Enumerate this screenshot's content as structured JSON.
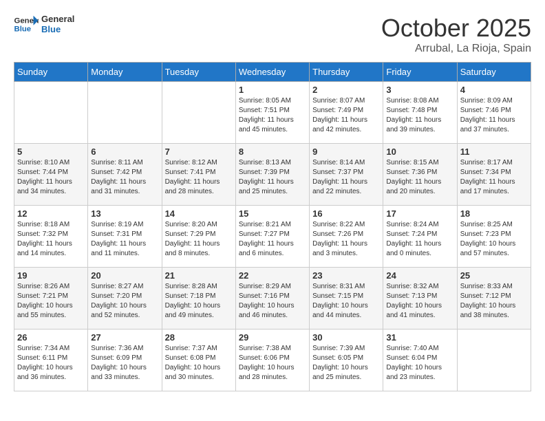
{
  "logo": {
    "line1": "General",
    "line2": "Blue"
  },
  "title": "October 2025",
  "subtitle": "Arrubal, La Rioja, Spain",
  "weekdays": [
    "Sunday",
    "Monday",
    "Tuesday",
    "Wednesday",
    "Thursday",
    "Friday",
    "Saturday"
  ],
  "weeks": [
    [
      {
        "day": "",
        "info": ""
      },
      {
        "day": "",
        "info": ""
      },
      {
        "day": "",
        "info": ""
      },
      {
        "day": "1",
        "info": "Sunrise: 8:05 AM\nSunset: 7:51 PM\nDaylight: 11 hours and 45 minutes."
      },
      {
        "day": "2",
        "info": "Sunrise: 8:07 AM\nSunset: 7:49 PM\nDaylight: 11 hours and 42 minutes."
      },
      {
        "day": "3",
        "info": "Sunrise: 8:08 AM\nSunset: 7:48 PM\nDaylight: 11 hours and 39 minutes."
      },
      {
        "day": "4",
        "info": "Sunrise: 8:09 AM\nSunset: 7:46 PM\nDaylight: 11 hours and 37 minutes."
      }
    ],
    [
      {
        "day": "5",
        "info": "Sunrise: 8:10 AM\nSunset: 7:44 PM\nDaylight: 11 hours and 34 minutes."
      },
      {
        "day": "6",
        "info": "Sunrise: 8:11 AM\nSunset: 7:42 PM\nDaylight: 11 hours and 31 minutes."
      },
      {
        "day": "7",
        "info": "Sunrise: 8:12 AM\nSunset: 7:41 PM\nDaylight: 11 hours and 28 minutes."
      },
      {
        "day": "8",
        "info": "Sunrise: 8:13 AM\nSunset: 7:39 PM\nDaylight: 11 hours and 25 minutes."
      },
      {
        "day": "9",
        "info": "Sunrise: 8:14 AM\nSunset: 7:37 PM\nDaylight: 11 hours and 22 minutes."
      },
      {
        "day": "10",
        "info": "Sunrise: 8:15 AM\nSunset: 7:36 PM\nDaylight: 11 hours and 20 minutes."
      },
      {
        "day": "11",
        "info": "Sunrise: 8:17 AM\nSunset: 7:34 PM\nDaylight: 11 hours and 17 minutes."
      }
    ],
    [
      {
        "day": "12",
        "info": "Sunrise: 8:18 AM\nSunset: 7:32 PM\nDaylight: 11 hours and 14 minutes."
      },
      {
        "day": "13",
        "info": "Sunrise: 8:19 AM\nSunset: 7:31 PM\nDaylight: 11 hours and 11 minutes."
      },
      {
        "day": "14",
        "info": "Sunrise: 8:20 AM\nSunset: 7:29 PM\nDaylight: 11 hours and 8 minutes."
      },
      {
        "day": "15",
        "info": "Sunrise: 8:21 AM\nSunset: 7:27 PM\nDaylight: 11 hours and 6 minutes."
      },
      {
        "day": "16",
        "info": "Sunrise: 8:22 AM\nSunset: 7:26 PM\nDaylight: 11 hours and 3 minutes."
      },
      {
        "day": "17",
        "info": "Sunrise: 8:24 AM\nSunset: 7:24 PM\nDaylight: 11 hours and 0 minutes."
      },
      {
        "day": "18",
        "info": "Sunrise: 8:25 AM\nSunset: 7:23 PM\nDaylight: 10 hours and 57 minutes."
      }
    ],
    [
      {
        "day": "19",
        "info": "Sunrise: 8:26 AM\nSunset: 7:21 PM\nDaylight: 10 hours and 55 minutes."
      },
      {
        "day": "20",
        "info": "Sunrise: 8:27 AM\nSunset: 7:20 PM\nDaylight: 10 hours and 52 minutes."
      },
      {
        "day": "21",
        "info": "Sunrise: 8:28 AM\nSunset: 7:18 PM\nDaylight: 10 hours and 49 minutes."
      },
      {
        "day": "22",
        "info": "Sunrise: 8:29 AM\nSunset: 7:16 PM\nDaylight: 10 hours and 46 minutes."
      },
      {
        "day": "23",
        "info": "Sunrise: 8:31 AM\nSunset: 7:15 PM\nDaylight: 10 hours and 44 minutes."
      },
      {
        "day": "24",
        "info": "Sunrise: 8:32 AM\nSunset: 7:13 PM\nDaylight: 10 hours and 41 minutes."
      },
      {
        "day": "25",
        "info": "Sunrise: 8:33 AM\nSunset: 7:12 PM\nDaylight: 10 hours and 38 minutes."
      }
    ],
    [
      {
        "day": "26",
        "info": "Sunrise: 7:34 AM\nSunset: 6:11 PM\nDaylight: 10 hours and 36 minutes."
      },
      {
        "day": "27",
        "info": "Sunrise: 7:36 AM\nSunset: 6:09 PM\nDaylight: 10 hours and 33 minutes."
      },
      {
        "day": "28",
        "info": "Sunrise: 7:37 AM\nSunset: 6:08 PM\nDaylight: 10 hours and 30 minutes."
      },
      {
        "day": "29",
        "info": "Sunrise: 7:38 AM\nSunset: 6:06 PM\nDaylight: 10 hours and 28 minutes."
      },
      {
        "day": "30",
        "info": "Sunrise: 7:39 AM\nSunset: 6:05 PM\nDaylight: 10 hours and 25 minutes."
      },
      {
        "day": "31",
        "info": "Sunrise: 7:40 AM\nSunset: 6:04 PM\nDaylight: 10 hours and 23 minutes."
      },
      {
        "day": "",
        "info": ""
      }
    ]
  ]
}
